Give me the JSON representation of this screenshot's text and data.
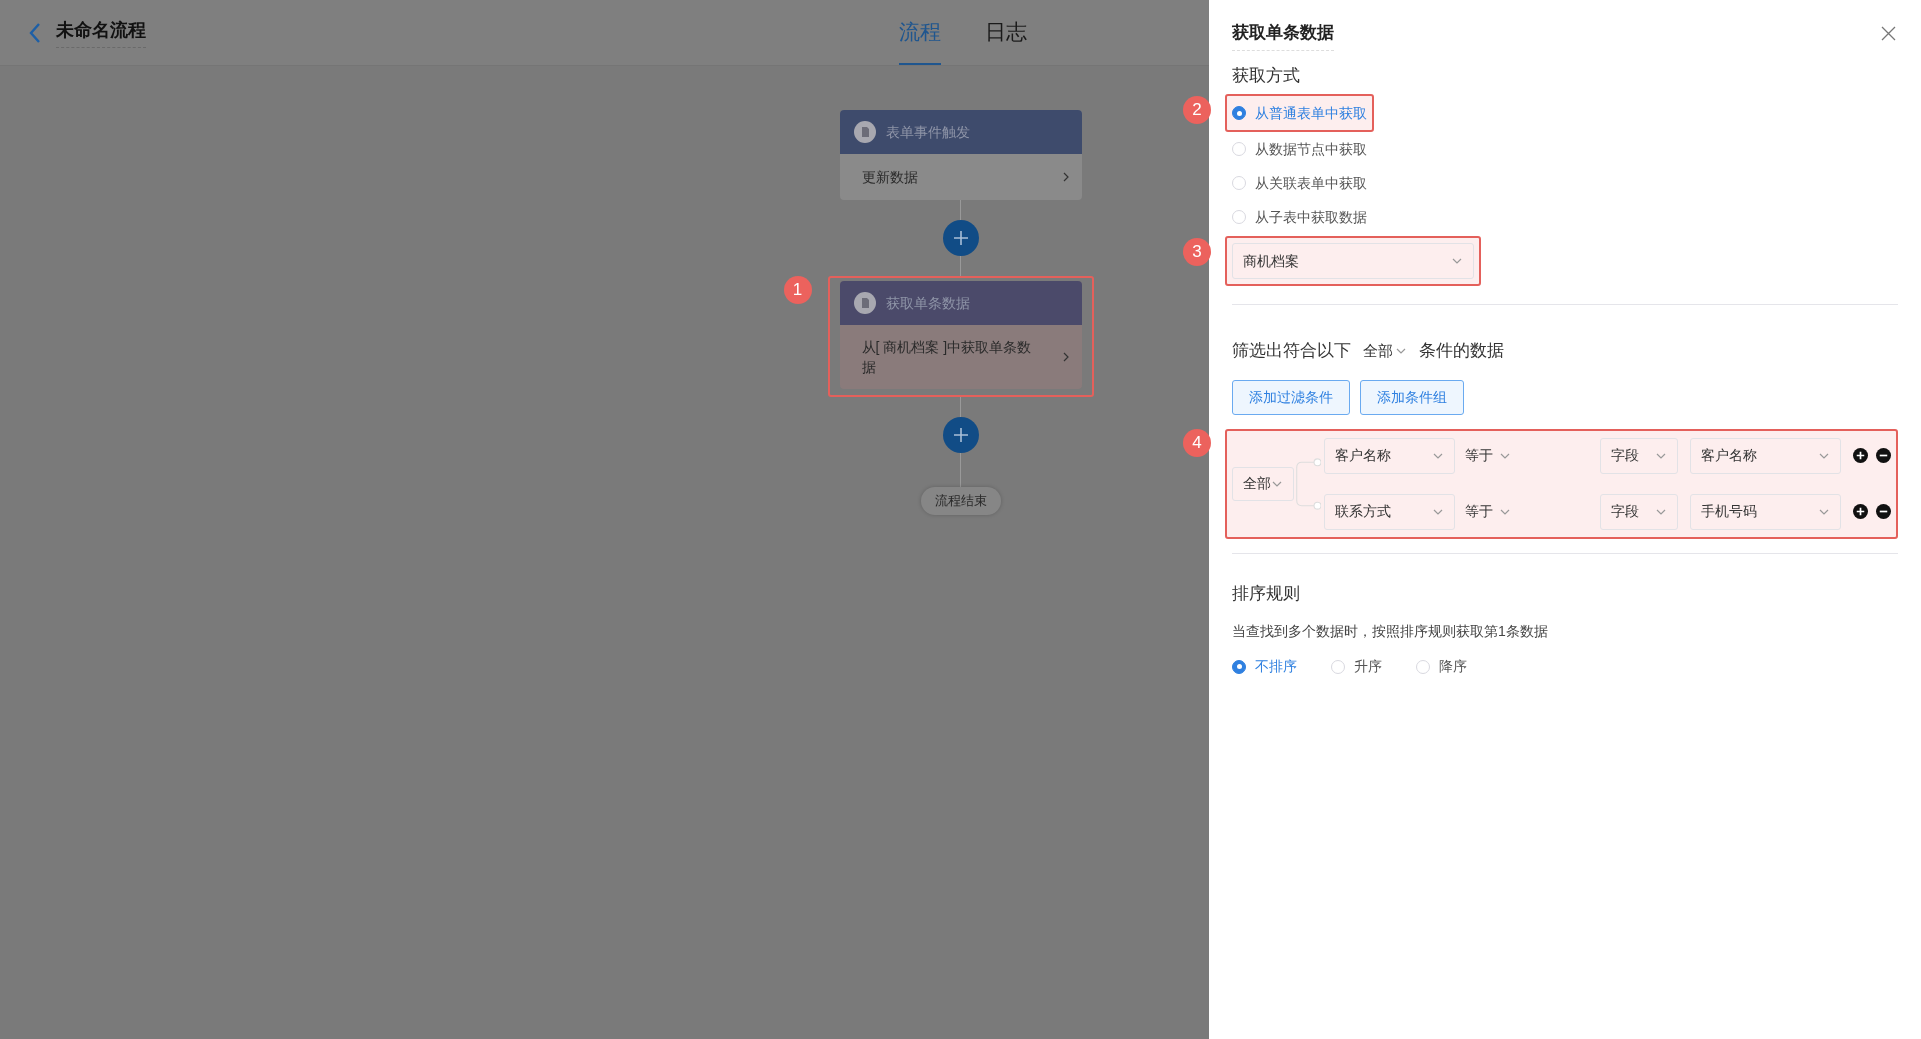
{
  "header": {
    "title": "未命名流程"
  },
  "tabs": [
    {
      "label": "流程",
      "selected": true
    },
    {
      "label": "日志",
      "selected": false
    }
  ],
  "flow": {
    "nodes": [
      {
        "title": "表单事件触发",
        "body": "更新数据"
      },
      {
        "title": "获取单条数据",
        "body": "从[ 商机档案 ]中获取单条数据",
        "marker": "1"
      }
    ],
    "end": "流程结束"
  },
  "panel": {
    "title": "获取单条数据",
    "method_label": "获取方式",
    "methods": [
      {
        "label": "从普通表单中获取",
        "selected": true,
        "marker": "2"
      },
      {
        "label": "从数据节点中获取",
        "selected": false
      },
      {
        "label": "从关联表单中获取",
        "selected": false
      },
      {
        "label": "从子表中获取数据",
        "selected": false
      }
    ],
    "form_select": {
      "value": "商机档案",
      "marker": "3"
    },
    "filter": {
      "prefix": "筛选出符合以下",
      "mode": "全部",
      "suffix": "条件的数据",
      "buttons": [
        "添加过滤条件",
        "添加条件组"
      ],
      "marker": "4",
      "group_mode": "全部",
      "conditions": [
        {
          "field": "客户名称",
          "operator": "等于",
          "value_type": "字段",
          "value": "客户名称"
        },
        {
          "field": "联系方式",
          "operator": "等于",
          "value_type": "字段",
          "value": "手机号码"
        }
      ]
    },
    "sort": {
      "title": "排序规则",
      "hint": "当查找到多个数据时，按照排序规则获取第1条数据",
      "options": [
        {
          "label": "不排序",
          "selected": true
        },
        {
          "label": "升序",
          "selected": false
        },
        {
          "label": "降序",
          "selected": false
        }
      ]
    }
  }
}
